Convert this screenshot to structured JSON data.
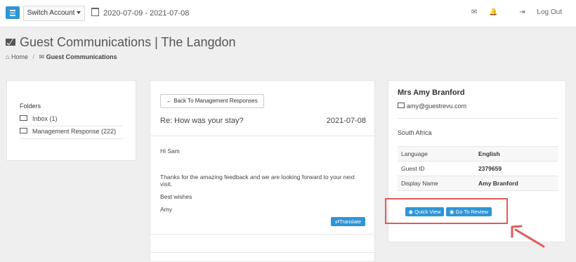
{
  "topbar": {
    "switch_account": "Switch Account",
    "date_range": "2020-07-09 - 2021-07-08",
    "logout": "Log Out"
  },
  "page": {
    "title": "Guest Communications | The Langdon",
    "breadcrumb_home": "Home",
    "breadcrumb_separator": "/",
    "breadcrumb_current": "Guest Communications"
  },
  "folders": {
    "heading": "Folders",
    "items": [
      {
        "label": "Inbox (1)"
      },
      {
        "label": "Management Response (222)"
      }
    ]
  },
  "message": {
    "back_label": "Back To Management Responses",
    "subject": "Re: How was your stay?",
    "date": "2021-07-08",
    "greeting": "Hi Sam",
    "body": "Thanks for the amazing feedback and we are looking forward to your next visit.",
    "signoff": "Best wishes",
    "sender": "Amy",
    "translate_label": "Translate"
  },
  "guest": {
    "name": "Mrs Amy Branford",
    "email": "amy@guestrevu.com",
    "country": "South Africa",
    "rows": [
      {
        "label": "Language",
        "value": "English"
      },
      {
        "label": "Guest ID",
        "value": "2379659"
      },
      {
        "label": "Display Name",
        "value": "Amy Branford"
      }
    ],
    "quick_view": "Quick View",
    "go_to_review": "Go To Review"
  },
  "colors": {
    "accent": "#2f95d6",
    "highlight": "#e05a5a"
  }
}
